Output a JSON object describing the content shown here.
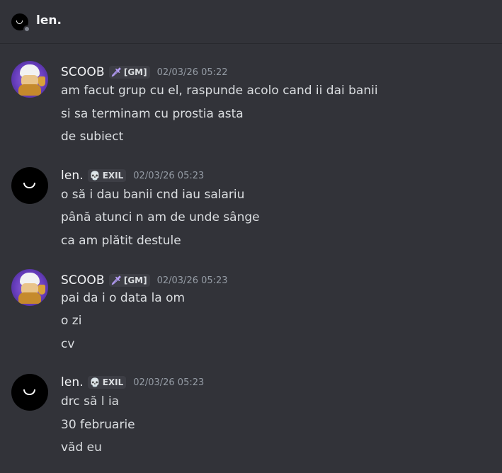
{
  "header": {
    "title": "len.",
    "avatar_icon": "smiley-avatar-icon"
  },
  "messages": [
    {
      "author": "SCOOB",
      "tag_icon": "sword-icon",
      "tag_glyph": "🗡",
      "tag": "[GM]",
      "timestamp": "02/03/26 05:22",
      "lines": [
        "am facut grup cu el, raspunde acolo cand ii dai banii",
        "si sa terminam cu prostia asta",
        "de subiect"
      ]
    },
    {
      "author": "len.",
      "tag_icon": "skull-icon",
      "tag_glyph": "💀",
      "tag": "EXIL",
      "timestamp": "02/03/26 05:23",
      "lines": [
        "o să i dau banii cnd iau salariu",
        "până atunci n am de unde sânge",
        "ca am plătit destule"
      ]
    },
    {
      "author": "SCOOB",
      "tag_icon": "sword-icon",
      "tag_glyph": "🗡",
      "tag": "[GM]",
      "timestamp": "02/03/26 05:23",
      "lines": [
        "pai da i o data la om",
        "o zi",
        "cv"
      ]
    },
    {
      "author": "len.",
      "tag_icon": "skull-icon",
      "tag_glyph": "💀",
      "tag": "EXIL",
      "timestamp": "02/03/26 05:23",
      "lines": [
        "drc să l ia",
        "30 februarie",
        "văd eu"
      ]
    }
  ]
}
